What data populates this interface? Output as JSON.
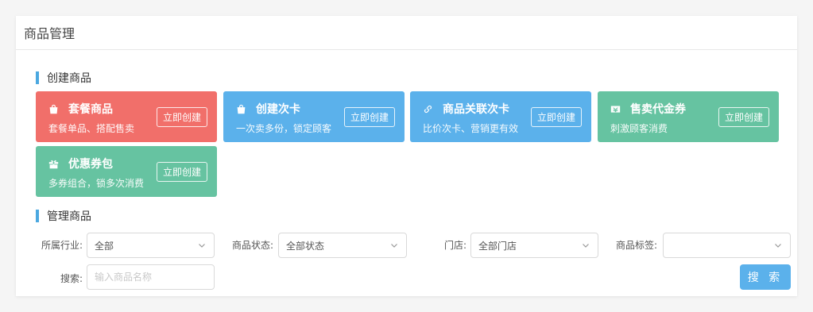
{
  "page_title": "商品管理",
  "create_section": {
    "title": "创建商品",
    "cards": [
      {
        "icon": "bag-icon",
        "title": "套餐商品",
        "desc": "套餐单品、搭配售卖",
        "button": "立即创建",
        "color": "#f16f6a"
      },
      {
        "icon": "bag-icon",
        "title": "创建次卡",
        "desc": "一次卖多份，锁定顾客",
        "button": "立即创建",
        "color": "#5bb1eb"
      },
      {
        "icon": "link-icon",
        "title": "商品关联次卡",
        "desc": "比价次卡、营销更有效",
        "button": "立即创建",
        "color": "#5bb1eb"
      },
      {
        "icon": "ticket-icon",
        "title": "售卖代金券",
        "desc": "刺激顾客消费",
        "button": "立即创建",
        "color": "#66c3a1"
      },
      {
        "icon": "gift-icon",
        "title": "优惠券包",
        "desc": "多券组合，锁多次消费",
        "button": "立即创建",
        "color": "#66c3a1"
      }
    ]
  },
  "manage_section": {
    "title": "管理商品",
    "filters": {
      "industry": {
        "label": "所属行业:",
        "value": "全部"
      },
      "status": {
        "label": "商品状态:",
        "value": "全部状态"
      },
      "store": {
        "label": "门店:",
        "value": "全部门店"
      },
      "tag": {
        "label": "商品标签:",
        "value": ""
      },
      "search": {
        "label": "搜索:",
        "placeholder": "输入商品名称",
        "value": ""
      }
    },
    "search_button": "搜 索"
  }
}
